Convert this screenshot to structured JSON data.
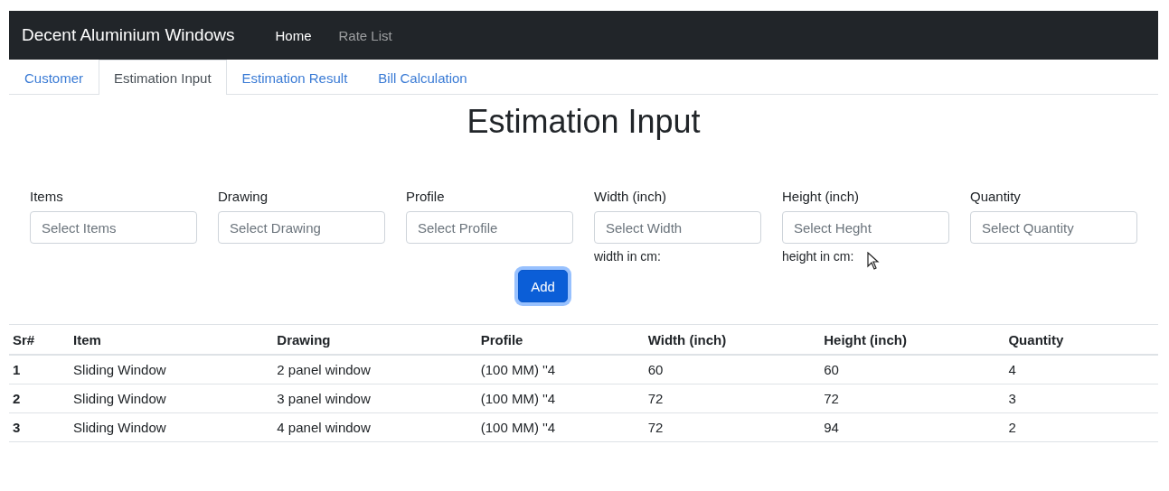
{
  "navbar": {
    "brand": "Decent Aluminium Windows",
    "links": [
      {
        "label": "Home",
        "selected": true
      },
      {
        "label": "Rate List",
        "selected": false
      }
    ]
  },
  "tabs": [
    {
      "label": "Customer",
      "selected": false
    },
    {
      "label": "Estimation Input",
      "selected": true
    },
    {
      "label": "Estimation Result",
      "selected": false
    },
    {
      "label": "Bill Calculation",
      "selected": false
    }
  ],
  "heading": "Estimation Input",
  "fields": [
    {
      "label": "Items",
      "placeholder": "Select Items"
    },
    {
      "label": "Drawing",
      "placeholder": "Select Drawing"
    },
    {
      "label": "Profile",
      "placeholder": "Select Profile"
    },
    {
      "label": "Width (inch)",
      "placeholder": "Select Width",
      "note": "width in cm:"
    },
    {
      "label": "Height (inch)",
      "placeholder": "Select Heght",
      "note": "height in cm:"
    },
    {
      "label": "Quantity",
      "placeholder": "Select Quantity"
    }
  ],
  "add_button": "Add",
  "table": {
    "columns": [
      "Sr#",
      "Item",
      "Drawing",
      "Profile",
      "Width (inch)",
      "Height (inch)",
      "Quantity"
    ],
    "rows": [
      [
        "1",
        "Sliding Window",
        "2 panel window",
        "(100 MM) ''4",
        "60",
        "60",
        "4"
      ],
      [
        "2",
        "Sliding Window",
        "3 panel window",
        "(100 MM) ''4",
        "72",
        "72",
        "3"
      ],
      [
        "3",
        "Sliding Window",
        "4 panel window",
        "(100 MM) ''4",
        "72",
        "94",
        "2"
      ]
    ]
  }
}
